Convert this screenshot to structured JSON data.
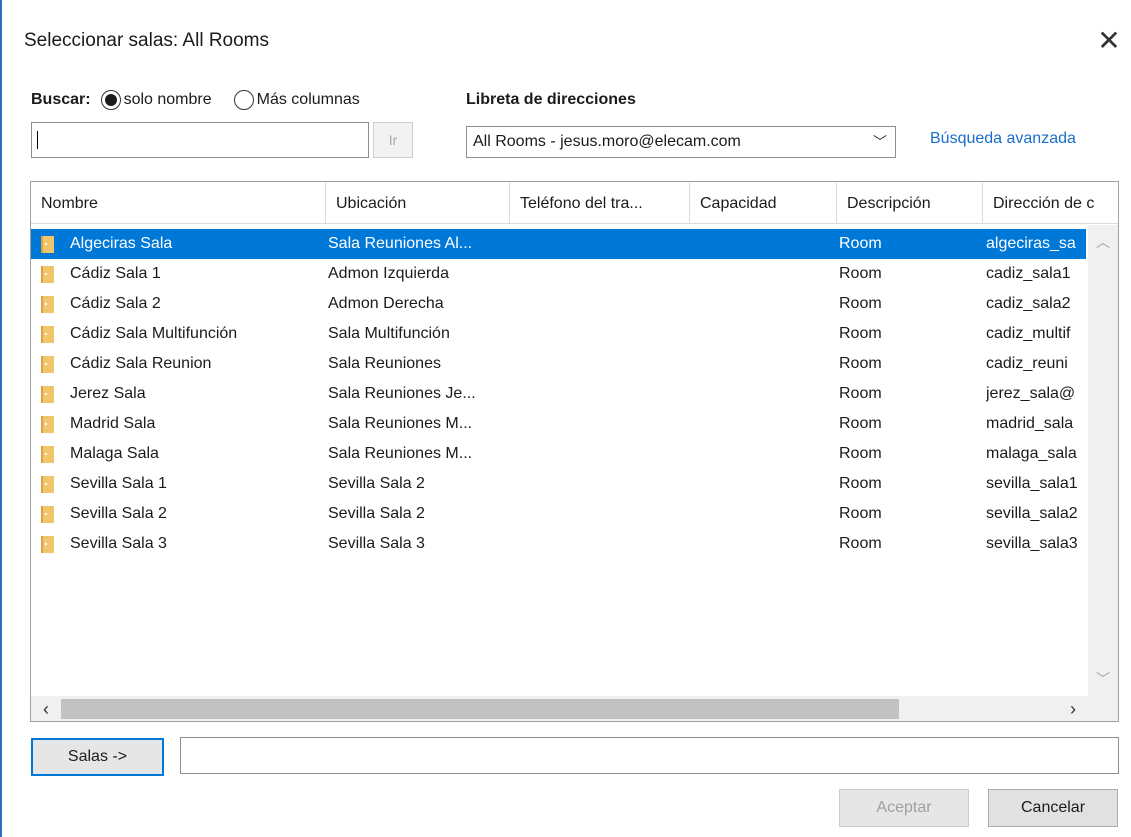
{
  "dialog": {
    "title": "Seleccionar salas: All Rooms",
    "close_icon": "close-icon"
  },
  "search": {
    "label": "Buscar:",
    "radio_name_only": "solo nombre",
    "radio_more_columns": "Más columnas",
    "selected_option": "solo nombre",
    "input_value": "",
    "go_label": "Ir"
  },
  "address_book": {
    "label": "Libreta de direcciones",
    "selected": "All Rooms - jesus.moro@elecam.com",
    "advanced_search": "Búsqueda avanzada"
  },
  "table": {
    "columns": [
      "Nombre",
      "Ubicación",
      "Teléfono del tra...",
      "Capacidad",
      "Descripción",
      "Dirección de c"
    ],
    "rows": [
      {
        "name": "Algeciras Sala",
        "location": "Sala Reuniones Al...",
        "phone": "",
        "capacity": "",
        "description": "Room",
        "address": "algeciras_sa"
      },
      {
        "name": "Cádiz Sala 1",
        "location": "Admon Izquierda",
        "phone": "",
        "capacity": "",
        "description": "Room",
        "address": "cadiz_sala1"
      },
      {
        "name": "Cádiz Sala 2",
        "location": "Admon Derecha",
        "phone": "",
        "capacity": "",
        "description": "Room",
        "address": "cadiz_sala2"
      },
      {
        "name": "Cádiz Sala Multifunción",
        "location": "Sala Multifunción",
        "phone": "",
        "capacity": "",
        "description": "Room",
        "address": "cadiz_multif"
      },
      {
        "name": "Cádiz Sala Reunion",
        "location": "Sala Reuniones",
        "phone": "",
        "capacity": "",
        "description": "Room",
        "address": "cadiz_reuni"
      },
      {
        "name": "Jerez Sala",
        "location": "Sala Reuniones Je...",
        "phone": "",
        "capacity": "",
        "description": "Room",
        "address": "jerez_sala@"
      },
      {
        "name": "Madrid Sala",
        "location": "Sala Reuniones M...",
        "phone": "",
        "capacity": "",
        "description": "Room",
        "address": "madrid_sala"
      },
      {
        "name": "Malaga Sala",
        "location": "Sala Reuniones M...",
        "phone": "",
        "capacity": "",
        "description": "Room",
        "address": "malaga_sala"
      },
      {
        "name": "Sevilla Sala 1",
        "location": "Sevilla Sala 2",
        "phone": "",
        "capacity": "",
        "description": "Room",
        "address": "sevilla_sala1"
      },
      {
        "name": "Sevilla Sala 2",
        "location": "Sevilla Sala 2",
        "phone": "",
        "capacity": "",
        "description": "Room",
        "address": "sevilla_sala2"
      },
      {
        "name": "Sevilla Sala 3",
        "location": "Sevilla Sala 3",
        "phone": "",
        "capacity": "",
        "description": "Room",
        "address": "sevilla_sala3"
      }
    ],
    "selected_row": 0,
    "row_icon": "room-icon"
  },
  "footer": {
    "salas_button": "Salas ->",
    "salas_value": "",
    "ok_label": "Aceptar",
    "cancel_label": "Cancelar"
  },
  "colors": {
    "selection": "#0078d7",
    "link": "#1a6ec8",
    "room_icon": "#f0c56b"
  }
}
